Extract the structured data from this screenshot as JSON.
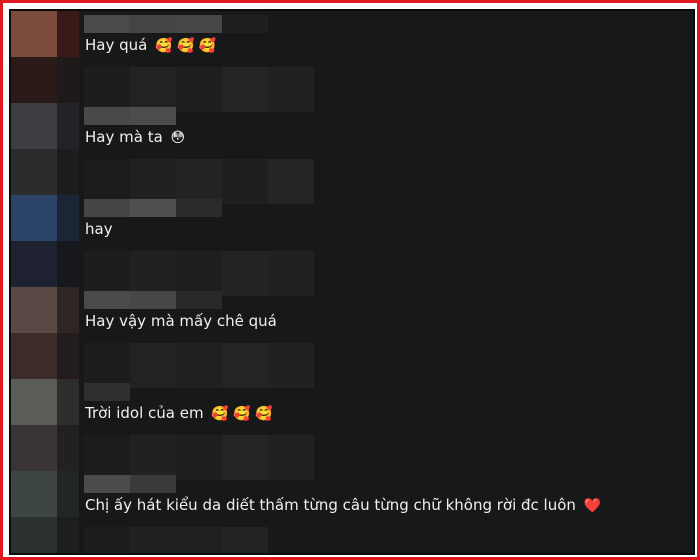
{
  "comments": [
    {
      "text": "Hay quá",
      "emoji": "🥰 🥰 🥰"
    },
    {
      "text": "Hay mà ta",
      "emoji": "😳"
    },
    {
      "text": "hay",
      "emoji": ""
    },
    {
      "text": "Hay vậy mà mấy chê quá",
      "emoji": ""
    },
    {
      "text": "Trời idol của em",
      "emoji": "🥰 🥰 🥰"
    },
    {
      "text": "Chị ấy hát kiểu da diết thấm từng câu từng chữ không rời đc luôn",
      "emoji": "❤️"
    }
  ],
  "colors": {
    "background": "#17181a",
    "text": "#f0f0f0",
    "frame": "#e0191f"
  }
}
